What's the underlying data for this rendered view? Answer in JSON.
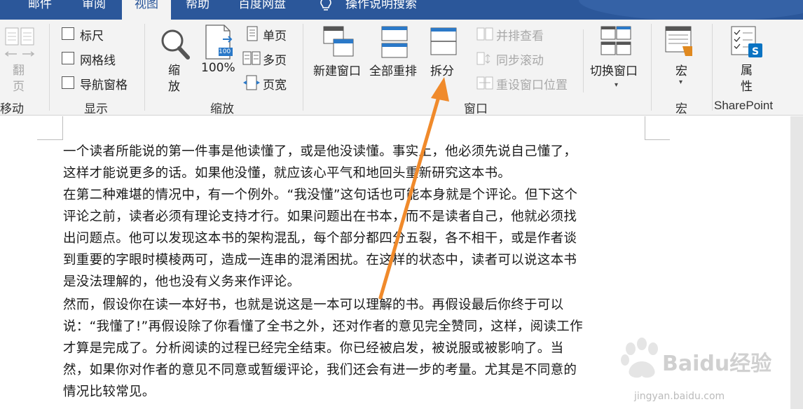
{
  "tabs": {
    "mail": "邮件",
    "review": "审阅",
    "view": "视图",
    "help": "帮助",
    "baidu_netdisk": "百度网盘",
    "tell_me": "操作说明搜索"
  },
  "ribbon": {
    "page_movement": {
      "line1": "翻",
      "line2": "页",
      "group": "移动"
    },
    "show": {
      "ruler": "标尺",
      "gridlines": "网格线",
      "nav_pane": "导航窗格",
      "group": "显示"
    },
    "zoom": {
      "zoom_line1": "缩",
      "zoom_line2": "放",
      "hundred": "100%",
      "hundred_badge": "100",
      "one_page": "单页",
      "multi_page": "多页",
      "page_width": "页宽",
      "group": "缩放"
    },
    "window": {
      "new_window": "新建窗口",
      "arrange_all": "全部重排",
      "split": "拆分",
      "side_by_side": "并排查看",
      "sync_scroll": "同步滚动",
      "reset_position": "重设窗口位置",
      "switch_windows": "切换窗口",
      "group": "窗口"
    },
    "macros": {
      "label": "宏",
      "group": "宏"
    },
    "sharepoint": {
      "line1": "属",
      "line2": "性",
      "group": "SharePoint"
    }
  },
  "document": {
    "paragraphs": [
      "一个读者所能说的第一件事是他读懂了，或是他没读懂。事实上，他必须先说自己懂了，这样才能说更多的话。如果他没懂，就应该心平气和地回头重新研究这本书。",
      "在第二种难堪的情况中，有一个例外。“我没懂”这句话也可能本身就是个评论。但下这个评论之前，读者必须有理论支持才行。如果问题出在书本，而不是读者自己，他就必须找出问题点。他可以发现这本书的架构混乱，每个部分都四分五裂，各不相干，或是作者谈到重要的字眼时模棱两可，造成一连串的混淆困扰。在这样的状态中，读者可以说这本书是没法理解的，他也没有义务来作评论。",
      "然而，假设你在读一本好书，也就是说这是一本可以理解的书。再假设最后你终于可以说：“我懂了!”再假设除了你看懂了全书之外，还对作者的意见完全赞同，这样，阅读工作才算是完成了。分析阅读的过程已经完全结束。你已经被启发，被说服或被影响了。当然，如果你对作者的意见不同意或暂缓评论，我们还会有进一步的考量。尤其是不同意的情况比较常见。"
    ],
    "lines": [
      "一个读者所能说的第一件事是他读懂了，或是他没读懂。事实上，他必须先说自己懂了，",
      "这样才能说更多的话。如果他没懂，就应该心平气和地回头重新研究这本书。",
      "在第二种难堪的情况中，有一个例外。“我没懂”这句话也可能本身就是个评论。但下这个",
      "评论之前，读者必须有理论支持才行。如果问题出在书本，而不是读者自己，他就必须找",
      "出问题点。他可以发现这本书的架构混乱，每个部分都四分五裂，各不相干，或是作者谈",
      "到重要的字眼时模棱两可，造成一连串的混淆困扰。在这样的状态中，读者可以说这本书",
      "是没法理解的，他也没有义务来作评论。",
      "然而，假设你在读一本好书，也就是说这是一本可以理解的书。再假设最后你终于可以",
      "说：“我懂了!”再假设除了你看懂了全书之外，还对作者的意见完全赞同，这样，阅读工作",
      "才算是完成了。分析阅读的过程已经完全结束。你已经被启发，被说服或被影响了。当",
      "然，如果你对作者的意见不同意或暂缓评论，我们还会有进一步的考量。尤其是不同意的",
      "情况比较常见。"
    ]
  },
  "watermark": {
    "brand": "Baidu经验",
    "url": "jingyan.baidu.com"
  },
  "colors": {
    "accent": "#2b579a",
    "arrow": "#f08a2b",
    "ribbon_bg": "#f3f3f3"
  }
}
